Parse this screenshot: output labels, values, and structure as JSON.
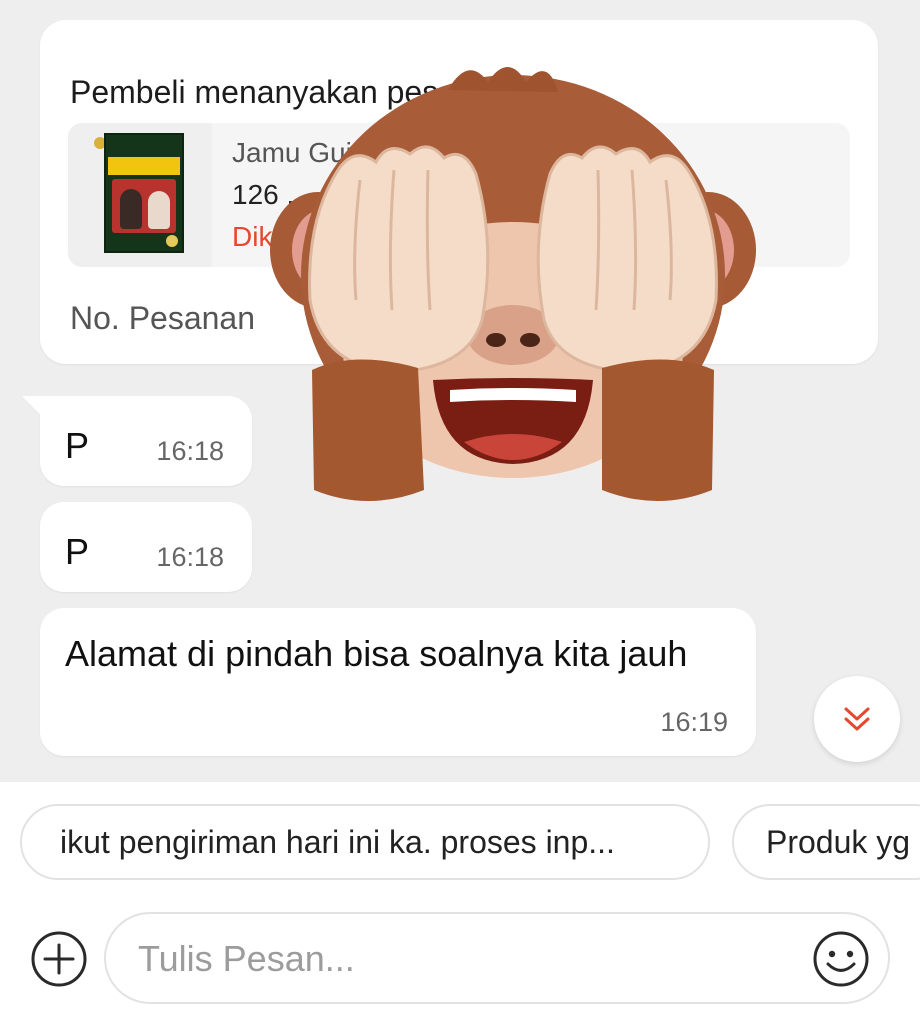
{
  "product_card": {
    "header": "Pembeli menanyakan pesanan ini",
    "product_name": "Jamu Gui... 10 sachet",
    "quantity": "126 ...",
    "status": "Dik...",
    "order_label": "No. Pesanan"
  },
  "messages": [
    {
      "text": "P",
      "time": "16:18"
    },
    {
      "text": "P",
      "time": "16:18"
    },
    {
      "text": "Alamat di pindah bisa soalnya kita jauh",
      "time": "16:19"
    }
  ],
  "quick_replies": [
    {
      "label": "ikut pengiriman hari ini ka. proses inp..."
    },
    {
      "label": "Produk yg"
    }
  ],
  "composer": {
    "placeholder": "Tulis Pesan..."
  },
  "icons": {
    "scroll_down": "chevron-double-down-icon",
    "add": "plus-circle-icon",
    "emoji": "smiley-icon",
    "sticker": "see-no-evil-monkey"
  },
  "colors": {
    "accent": "#e5482e",
    "background": "#eeeeee",
    "bubble": "#ffffff",
    "placeholder": "#9c9c9c"
  }
}
